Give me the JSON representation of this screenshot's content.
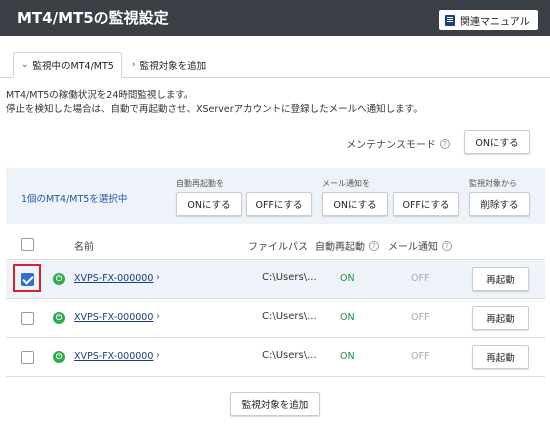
{
  "header": {
    "title": "MT4/MT5の監視設定",
    "manual_label": "関連マニュアル"
  },
  "tabs": [
    {
      "label": "監視中のMT4/MT5",
      "active": true
    },
    {
      "label": "監視対象を追加",
      "active": false
    }
  ],
  "description": {
    "line1": "MT4/MT5の稼働状況を24時間監視します。",
    "line2": "停止を検知した場合は、自動で再起動させ、XServerアカウントに登録したメールへ通知します。"
  },
  "maintenance": {
    "label": "メンテナンスモード",
    "button": "ONにする"
  },
  "bulk_actions": {
    "selected_text": "1個のMT4/MT5を選択中",
    "auto_restart": {
      "label": "自動再起動を",
      "on": "ONにする",
      "off": "OFFにする"
    },
    "mail_notify": {
      "label": "メール通知を",
      "on": "ONにする",
      "off": "OFFにする"
    },
    "monitor": {
      "label": "監視対象から",
      "delete": "削除する"
    }
  },
  "table": {
    "headers": {
      "name": "名前",
      "path": "ファイルパス",
      "auto_restart": "自動再起動",
      "mail": "メール通知"
    },
    "rows": [
      {
        "checked": true,
        "name": "XVPS-FX-000000",
        "path": "C:\\Users\\...",
        "auto_restart": "ON",
        "mail": "OFF",
        "action": "再起動"
      },
      {
        "checked": false,
        "name": "XVPS-FX-000000",
        "path": "C:\\Users\\...",
        "auto_restart": "ON",
        "mail": "OFF",
        "action": "再起動"
      },
      {
        "checked": false,
        "name": "XVPS-FX-000000",
        "path": "C:\\Users\\...",
        "auto_restart": "ON",
        "mail": "OFF",
        "action": "再起動"
      }
    ]
  },
  "footer": {
    "add_button": "監視対象を追加"
  },
  "colors": {
    "header_bg": "#3b4047",
    "accent_blue": "#2f6ed3",
    "link": "#1b3c82",
    "status_on": "#1d8f3a",
    "status_off": "#aaaaaa",
    "power": "#2eaa4f",
    "highlight": "#d9222a"
  },
  "icons": [
    "book-icon",
    "chevron-down-icon",
    "chevron-right-icon",
    "help-icon",
    "power-icon",
    "check-icon"
  ]
}
